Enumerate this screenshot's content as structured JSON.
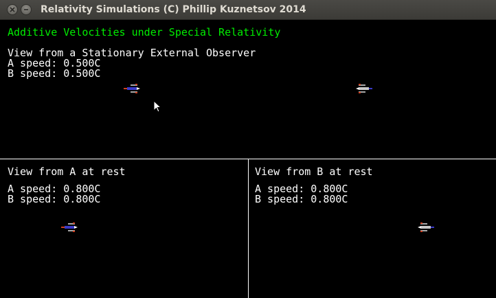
{
  "window": {
    "title": "Relativity Simulations (C) Phillip Kuznetsov 2014"
  },
  "heading": "Additive Velocities under Special Relativity",
  "views": {
    "external": {
      "title": "View from a Stationary External Observer",
      "a_speed": "A speed: 0.500C",
      "b_speed": "B speed: 0.500C"
    },
    "a_rest": {
      "title": "View from A at rest",
      "a_speed": "A speed: 0.800C",
      "b_speed": "B speed: 0.800C"
    },
    "b_rest": {
      "title": "View from B at rest",
      "a_speed": "A speed: 0.800C",
      "b_speed": "B speed: 0.800C"
    }
  },
  "colors": {
    "heading": "#00ee00",
    "text": "#ffffff",
    "background": "#000000",
    "ship_a_body": "#3a3ac8",
    "ship_b_body": "#c8c8c8",
    "engine": "#d04020"
  },
  "icons": {
    "close": "close-icon",
    "minimize": "minimize-icon",
    "ship_a": "spaceship-a-icon",
    "ship_b": "spaceship-b-icon",
    "cursor": "mouse-pointer-icon"
  }
}
